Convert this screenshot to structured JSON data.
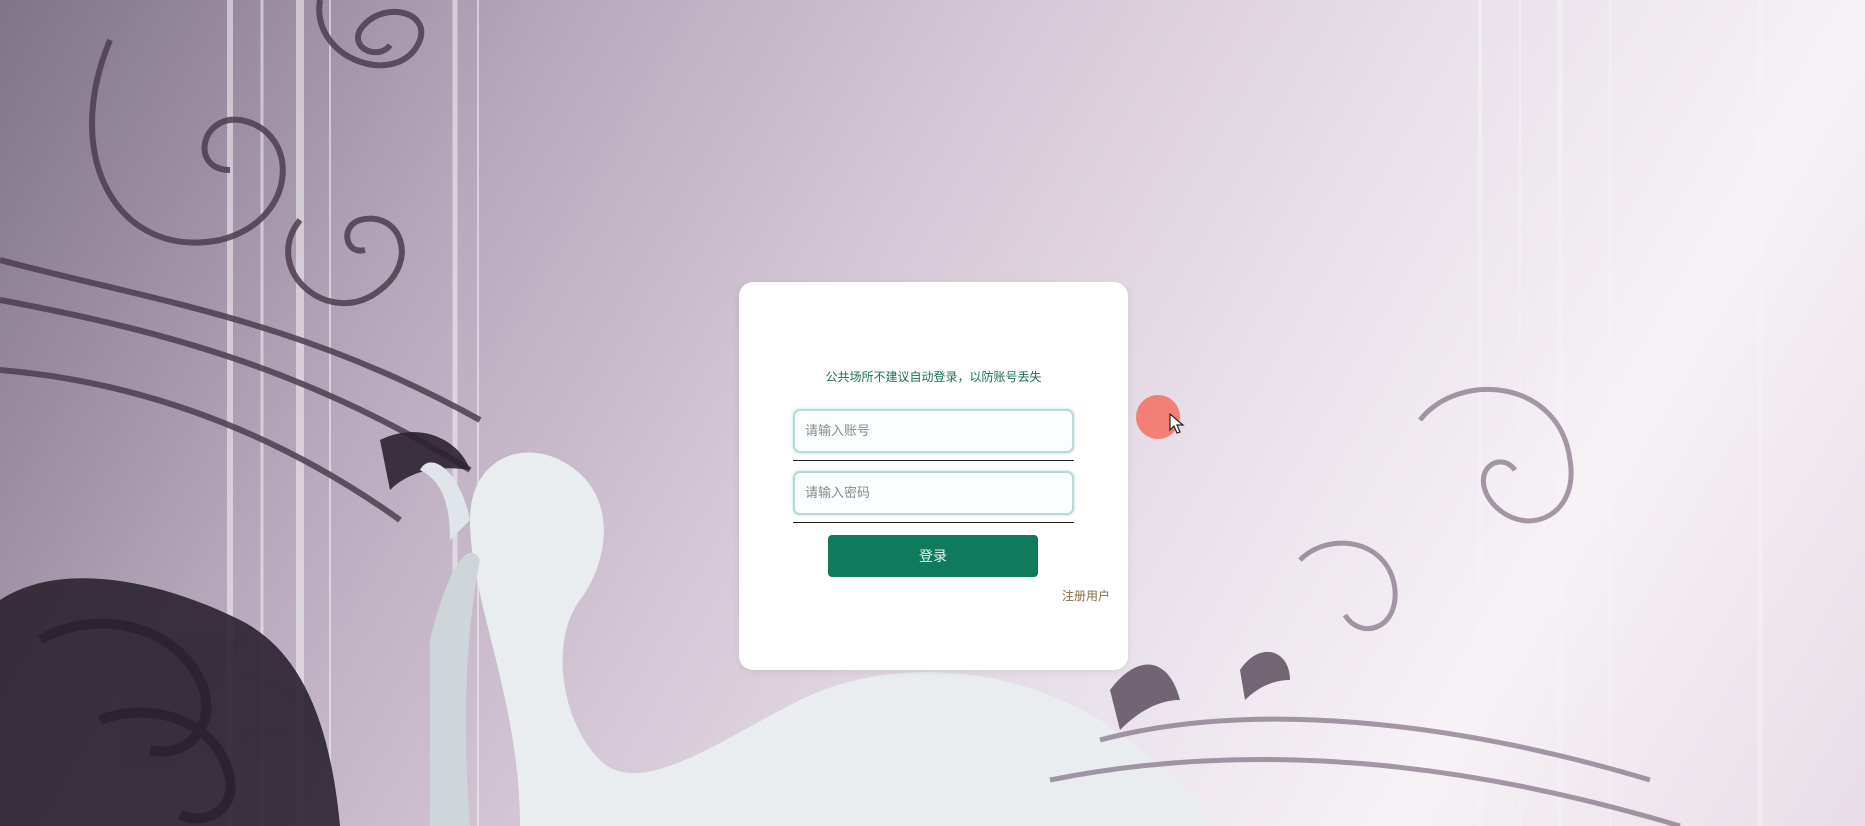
{
  "login": {
    "notice": "公共场所不建议自动登录，以防账号丢失",
    "username_placeholder": "请输入账号",
    "password_placeholder": "请输入密码",
    "login_label": "登录",
    "register_label": "注册用户"
  },
  "colors": {
    "accent": "#107a5c",
    "notice_text": "#1a6e58",
    "register_text": "#8a6a4a"
  }
}
